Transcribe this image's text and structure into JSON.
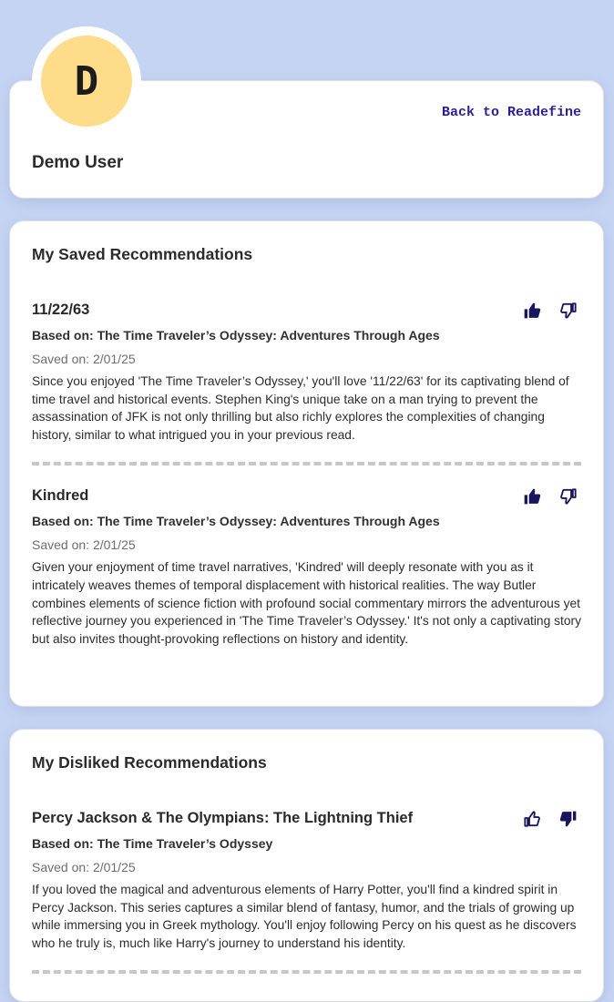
{
  "profile": {
    "avatar_letter": "D",
    "back_link": "Back to Readefine",
    "user_name": "Demo User",
    "avatar_color": "#fedc8a"
  },
  "saved": {
    "title": "My Saved Recommendations",
    "items": [
      {
        "title": "11/22/63",
        "based_on": "Based on: The Time Traveler’s Odyssey: Adventures Through Ages",
        "saved_on": "Saved on: 2/01/25",
        "description": "Since you enjoyed 'The Time Traveler’s Odyssey,' you'll love '11/22/63' for its captivating blend of time travel and historical events. Stephen King's unique take on a man trying to prevent the assassination of JFK is not only thrilling but also richly explores the complexities of changing history, similar to what intrigued you in your previous read.",
        "rating": "liked"
      },
      {
        "title": "Kindred",
        "based_on": "Based on: The Time Traveler’s Odyssey: Adventures Through Ages",
        "saved_on": "Saved on: 2/01/25",
        "description": "Given your enjoyment of time travel narratives, 'Kindred' will deeply resonate with you as it intricately weaves themes of temporal displacement with historical realities. The way Butler combines elements of science fiction with profound social commentary mirrors the adventurous yet reflective journey you experienced in 'The Time Traveler’s Odyssey.' It's not only a captivating story but also invites thought-provoking reflections on history and identity.",
        "rating": "liked"
      }
    ]
  },
  "disliked": {
    "title": "My Disliked Recommendations",
    "items": [
      {
        "title": "Percy Jackson & The Olympians: The Lightning Thief",
        "based_on": "Based on: The Time Traveler’s Odyssey",
        "saved_on": "Saved on: 2/01/25",
        "description": "If you loved the magical and adventurous elements of Harry Potter, you'll find a kindred spirit in Percy Jackson. This series captures a similar blend of fantasy, humor, and the trials of growing up while immersing you in Greek mythology. You'll enjoy following Percy on his quest as he discovers who he truly is, much like Harry's journey to understand his identity.",
        "rating": "disliked"
      }
    ]
  },
  "icons": {
    "like": "thumbs-up-icon",
    "dislike": "thumbs-down-icon"
  },
  "colors": {
    "background": "#c5d4f2",
    "accent": "#2a1f9a",
    "icon": "#18175e"
  }
}
